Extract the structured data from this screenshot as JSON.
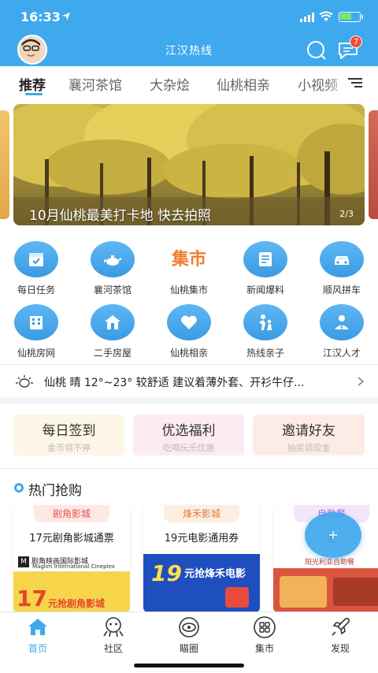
{
  "status_bar": {
    "time": "16:33"
  },
  "header": {
    "title": "江汉热线",
    "message_badge": "7"
  },
  "tabs": [
    {
      "label": "推荐",
      "active": true
    },
    {
      "label": "襄河茶馆"
    },
    {
      "label": "大杂烩"
    },
    {
      "label": "仙桃相亲"
    },
    {
      "label": "小视频"
    }
  ],
  "banner": {
    "caption": "10月仙桃最美打卡地 快去拍照",
    "page": "2/3"
  },
  "grid": [
    {
      "label": "每日任务",
      "icon": "calendar-icon"
    },
    {
      "label": "襄河茶馆",
      "icon": "teapot-icon"
    },
    {
      "label": "仙桃集市",
      "icon": "market-logo",
      "logo_text": "集市"
    },
    {
      "label": "新闻爆料",
      "icon": "newspaper-icon"
    },
    {
      "label": "顺风拼车",
      "icon": "car-icon"
    },
    {
      "label": "仙桃房网",
      "icon": "building-icon"
    },
    {
      "label": "二手房屋",
      "icon": "house-icon"
    },
    {
      "label": "仙桃相亲",
      "icon": "heart-icon"
    },
    {
      "label": "热线亲子",
      "icon": "parent-child-icon"
    },
    {
      "label": "江汉人才",
      "icon": "person-icon"
    }
  ],
  "weather": {
    "text": "仙桃 晴 12°~23° 较舒适 建议着薄外套、开衫牛仔..."
  },
  "promo": [
    {
      "title": "每日签到",
      "subtitle": "金币领不停",
      "bg": "#fdf6e6"
    },
    {
      "title": "优选福利",
      "subtitle": "吃喝玩乐优惠",
      "bg": "#fcebf1"
    },
    {
      "title": "邀请好友",
      "subtitle": "抽奖领现金",
      "bg": "#fdece6"
    }
  ],
  "hot": {
    "title": "热门抢购",
    "deals": [
      {
        "tag": "剧角影城",
        "title": "17元剧角影城通票",
        "tag_bg": "#fde8e6",
        "tag_color": "#e0574a",
        "img_text": "Magilm International Cineplex",
        "img_brand": "剧角映画国际影城",
        "img_big": "17",
        "img_line": "元抢剧角影城"
      },
      {
        "tag": "烽禾影城",
        "title": "19元电影通用券",
        "tag_bg": "#fdeee2",
        "tag_color": "#e07d3a",
        "img_big": "19",
        "img_line": "元抢烽禾电影"
      },
      {
        "tag": "自助餐",
        "title": "全",
        "tag_bg": "#f3e6fb",
        "tag_color": "#a566d6",
        "img_line": "阳光利亚自助餐"
      }
    ]
  },
  "bottom_nav": [
    {
      "label": "首页",
      "active": true,
      "icon": "home-icon"
    },
    {
      "label": "社区",
      "icon": "community-icon"
    },
    {
      "label": "瞄圈",
      "icon": "eye-icon"
    },
    {
      "label": "集市",
      "icon": "grid-icon"
    },
    {
      "label": "发现",
      "icon": "rocket-icon"
    }
  ],
  "colors": {
    "primary": "#3fa9ee",
    "badge": "#f04a3e"
  }
}
